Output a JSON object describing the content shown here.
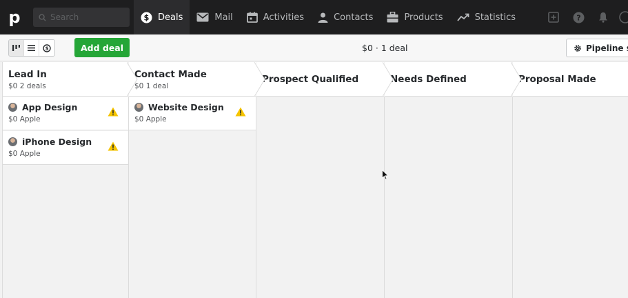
{
  "nav": {
    "logo": "p",
    "search_placeholder": "Search",
    "items": [
      {
        "label": "Deals",
        "icon": "dollar-circle-icon",
        "active": true
      },
      {
        "label": "Mail",
        "icon": "mail-icon",
        "active": false
      },
      {
        "label": "Activities",
        "icon": "calendar-icon",
        "active": false
      },
      {
        "label": "Contacts",
        "icon": "person-icon",
        "active": false
      },
      {
        "label": "Products",
        "icon": "box-icon",
        "active": false
      },
      {
        "label": "Statistics",
        "icon": "trend-icon",
        "active": false
      }
    ]
  },
  "toolbar": {
    "add_deal_label": "Add deal",
    "summary": "$0 · 1 deal",
    "pipeline_label": "Pipeline se"
  },
  "stages": [
    {
      "title": "Lead In",
      "sub": "$0 2 deals"
    },
    {
      "title": "Contact Made",
      "sub": "$0 1 deal"
    },
    {
      "title": "Prospect Qualified",
      "sub": ""
    },
    {
      "title": "Needs Defined",
      "sub": ""
    },
    {
      "title": "Proposal Made",
      "sub": ""
    }
  ],
  "deals": [
    {
      "title": "App Design",
      "sub": "$0  Apple"
    },
    {
      "title": "iPhone Design",
      "sub": "$0  Apple"
    },
    {
      "title": "Website Design",
      "sub": "$0  Apple"
    }
  ],
  "colors": {
    "accent_green": "#25a637",
    "topbar": "#1e1e1f",
    "warning": "#f5c400"
  }
}
